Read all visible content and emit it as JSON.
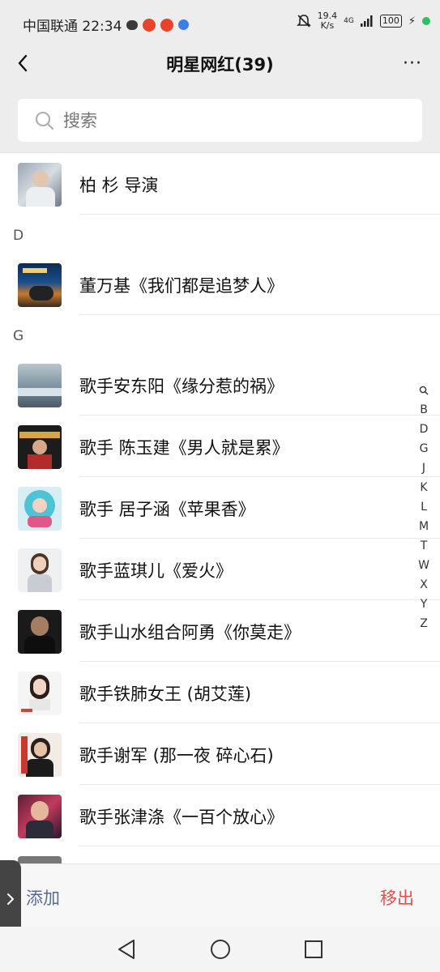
{
  "status_bar": {
    "carrier_time": "中国联通 22:34",
    "speed_value": "19.4",
    "speed_unit": "K/s",
    "network": "4G",
    "battery": "100"
  },
  "header": {
    "title": "明星网红(39)",
    "more": "···"
  },
  "search": {
    "placeholder": "搜索"
  },
  "contacts": [
    {
      "name": "柏  杉 导演",
      "section": ""
    },
    {
      "name": "董万基《我们都是追梦人》",
      "section": "D"
    },
    {
      "name": "歌手安东阳《缘分惹的祸》",
      "section": "G"
    },
    {
      "name": "歌手 陈玉建《男人就是累》",
      "section": "G"
    },
    {
      "name": "歌手 居子涵《苹果香》",
      "section": "G"
    },
    {
      "name": "歌手蓝琪儿《爱火》",
      "section": "G"
    },
    {
      "name": "歌手山水组合阿勇《你莫走》",
      "section": "G"
    },
    {
      "name": "歌手铁肺女王 (胡艾莲)",
      "section": "G"
    },
    {
      "name": "歌手谢军 (那一夜  碎心石)",
      "section": "G"
    },
    {
      "name": "歌手张津涤《一百个放心》",
      "section": "G"
    }
  ],
  "sections": {
    "d": "D",
    "g": "G"
  },
  "index_letters": [
    "B",
    "D",
    "G",
    "J",
    "K",
    "L",
    "M",
    "T",
    "W",
    "X",
    "Y",
    "Z"
  ],
  "bottom_bar": {
    "add_label": "添加",
    "remove_label": "移出"
  },
  "colors": {
    "link_blue": "#576b95",
    "danger_red": "#d9534f",
    "header_bg": "#ededed"
  }
}
